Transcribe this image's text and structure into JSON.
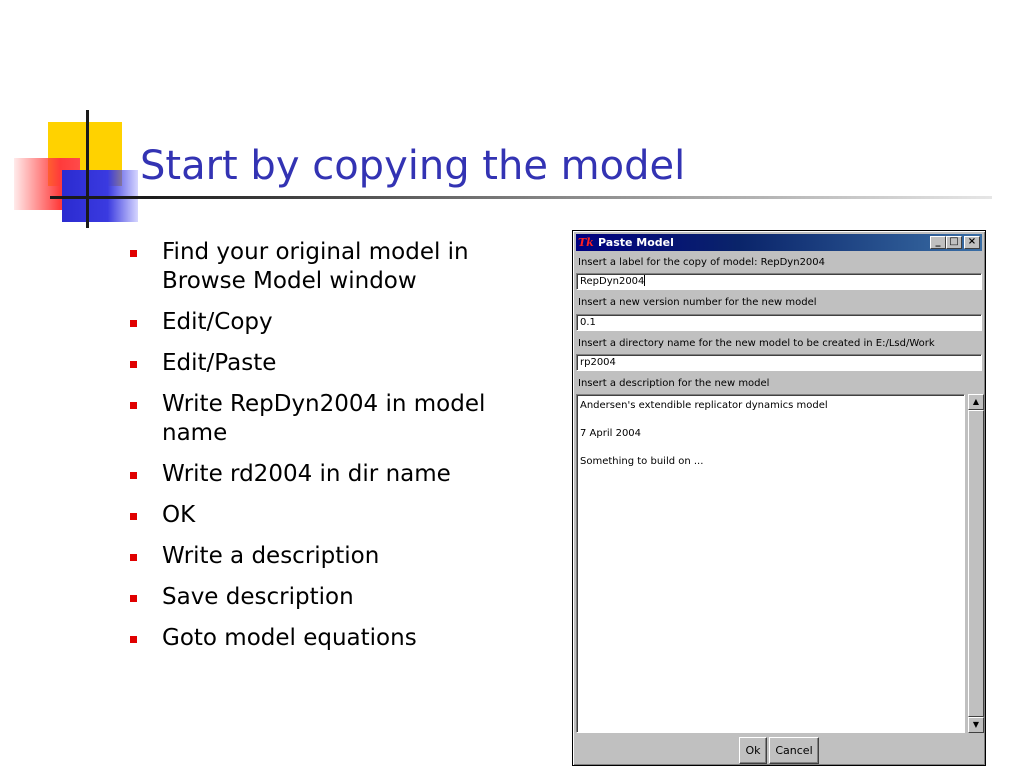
{
  "slide": {
    "title": "Start by copying the model",
    "bullets": [
      "Find your original model in Browse Model window",
      "Edit/Copy",
      "Edit/Paste",
      "Write RepDyn2004 in model name",
      "Write rd2004 in dir name",
      "OK",
      "Write a description",
      "Save description",
      "Goto model equations"
    ]
  },
  "dialog": {
    "icon_text": "Tk",
    "title": "Paste Model",
    "window_buttons": {
      "minimize": "_",
      "maximize": "□",
      "close": "×"
    },
    "label_name": "Insert a label for the copy of model: RepDyn2004",
    "value_name": "RepDyn2004",
    "label_version": "Insert a new version number for the new model",
    "value_version": "0.1",
    "label_dir": "Insert a directory name for the new model to be created in E:/Lsd/Work",
    "value_dir": "rp2004",
    "label_description": "Insert a description for the new model",
    "description_lines": [
      "Andersen's extendible replicator dynamics model",
      "7 April 2004",
      "Something to build on ..."
    ],
    "ok_label": "Ok",
    "cancel_label": "Cancel"
  },
  "colors": {
    "title": "#3333b3",
    "bullet": "#e00000",
    "titlebar": "#000080",
    "window_bg": "#c0c0c0"
  }
}
